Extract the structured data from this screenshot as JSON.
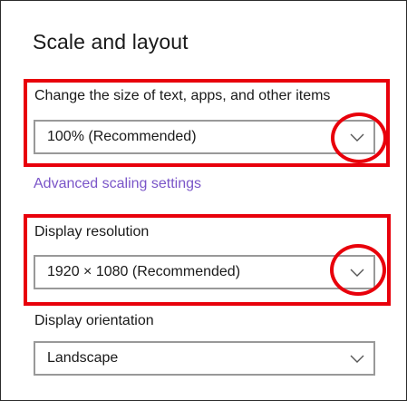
{
  "section": {
    "title": "Scale and layout"
  },
  "scale": {
    "label": "Change the size of text, apps, and other items",
    "value": "100% (Recommended)"
  },
  "advanced_link": "Advanced scaling settings",
  "resolution": {
    "label": "Display resolution",
    "value": "1920 × 1080 (Recommended)"
  },
  "orientation": {
    "label": "Display orientation",
    "value": "Landscape"
  },
  "colors": {
    "highlight": "#e8000b",
    "link": "#7a55c8",
    "dropdown_border": "#999999"
  },
  "icons": {
    "dropdown": "chevron-down-icon"
  }
}
